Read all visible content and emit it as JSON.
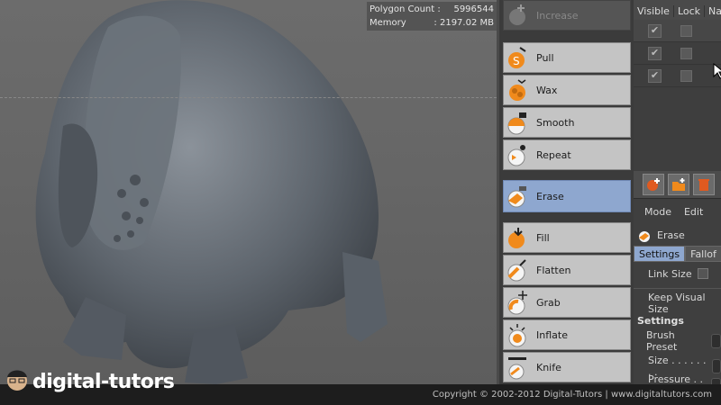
{
  "viewport": {
    "stats": {
      "polygon_label": "Polygon Count :",
      "polygon_value": "5996544",
      "memory_label": "Memory",
      "memory_value": ": 2197.02 MB"
    }
  },
  "brushes": [
    {
      "label": "Increase",
      "icon": "increase-icon",
      "state": "dim"
    },
    {
      "label": "Pull",
      "icon": "pull-icon",
      "state": "normal"
    },
    {
      "label": "Wax",
      "icon": "wax-icon",
      "state": "normal"
    },
    {
      "label": "Smooth",
      "icon": "smooth-icon",
      "state": "normal"
    },
    {
      "label": "Repeat",
      "icon": "repeat-icon",
      "state": "normal"
    },
    {
      "label": "Erase",
      "icon": "erase-icon",
      "state": "active"
    },
    {
      "label": "Fill",
      "icon": "fill-icon",
      "state": "normal"
    },
    {
      "label": "Flatten",
      "icon": "flatten-icon",
      "state": "normal"
    },
    {
      "label": "Grab",
      "icon": "grab-icon",
      "state": "normal"
    },
    {
      "label": "Inflate",
      "icon": "inflate-icon",
      "state": "normal"
    },
    {
      "label": "Knife",
      "icon": "knife-icon",
      "state": "normal"
    }
  ],
  "layers": {
    "headers": [
      "Visible",
      "Lock",
      "Nam"
    ],
    "rows": [
      {
        "visible": true,
        "locked": false
      },
      {
        "visible": true,
        "locked": false
      },
      {
        "visible": true,
        "locked": false
      }
    ]
  },
  "attributes": {
    "menu": [
      "Mode",
      "Edit"
    ],
    "tool_name": "Erase",
    "tabs": [
      "Settings",
      "Fallof"
    ],
    "link_size": "Link Size",
    "keep_visual_size": "Keep Visual Size",
    "group_title": "Settings",
    "brush_preset": "Brush Preset",
    "size": "Size . . . . . . . .",
    "pressure": "Pressure . . . ."
  },
  "footer": {
    "brand": "digital-tutors",
    "copyright": "Copyright © 2002-2012 Digital-Tutors  |  www.digitaltutors.com"
  },
  "colors": {
    "active_brush": "#8ea7cf",
    "brush_bg": "#c4c4c4",
    "accent_orange": "#f08a1c"
  }
}
